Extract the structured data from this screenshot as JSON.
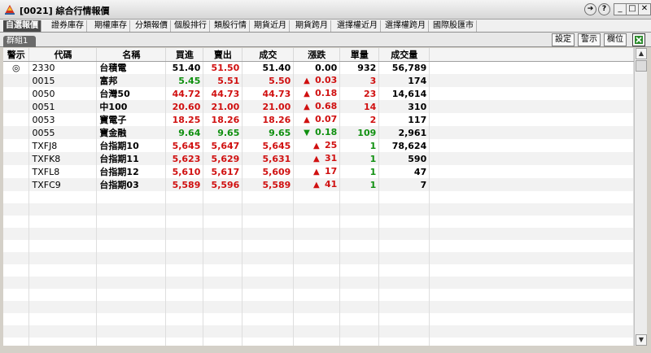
{
  "window": {
    "title": "[0021] 綜合行情報價",
    "help_glyph": "?",
    "next_glyph": "➔",
    "min_glyph": "_",
    "max_glyph": "□",
    "close_glyph": "✕"
  },
  "tabs": [
    {
      "label": "自選報價",
      "active": true
    },
    {
      "label": "證券庫存"
    },
    {
      "label": "期權庫存"
    },
    {
      "label": "分類報價"
    },
    {
      "label": "個股排行"
    },
    {
      "label": "類股行情"
    },
    {
      "label": "期貨近月"
    },
    {
      "label": "期貨跨月"
    },
    {
      "label": "選擇權近月"
    },
    {
      "label": "選擇權跨月"
    },
    {
      "label": "國際股匯市"
    }
  ],
  "toolbar": {
    "group_tab": "群組1",
    "settings": "設定",
    "alert": "警示",
    "columns": "欄位"
  },
  "table": {
    "headers": [
      "警示",
      "代碼",
      "名稱",
      "買進",
      "賣出",
      "成交",
      "漲跌",
      "單量",
      "成交量"
    ],
    "rows": [
      {
        "alert": "◎",
        "code": "2330",
        "name": "台積電",
        "bid": "51.40",
        "ask": "51.50",
        "last": "51.40",
        "dir": "",
        "change": "0.00",
        "qty": "932",
        "vol": "56,789",
        "bidc": "black",
        "askc": "red",
        "lastc": "black",
        "chgc": "black"
      },
      {
        "alert": "",
        "code": "0015",
        "name": "富邦",
        "bid": "5.45",
        "ask": "5.51",
        "last": "5.50",
        "dir": "▲",
        "change": "0.03",
        "qty": "3",
        "vol": "174",
        "bidc": "green",
        "askc": "red",
        "lastc": "red",
        "chgc": "red"
      },
      {
        "alert": "",
        "code": "0050",
        "name": "台灣50",
        "bid": "44.72",
        "ask": "44.73",
        "last": "44.73",
        "dir": "▲",
        "change": "0.18",
        "qty": "23",
        "vol": "14,614",
        "bidc": "red",
        "askc": "red",
        "lastc": "red",
        "chgc": "red"
      },
      {
        "alert": "",
        "code": "0051",
        "name": "中100",
        "bid": "20.60",
        "ask": "21.00",
        "last": "21.00",
        "dir": "▲",
        "change": "0.68",
        "qty": "14",
        "vol": "310",
        "bidc": "red",
        "askc": "red",
        "lastc": "red",
        "chgc": "red"
      },
      {
        "alert": "",
        "code": "0053",
        "name": "寶電子",
        "bid": "18.25",
        "ask": "18.26",
        "last": "18.26",
        "dir": "▲",
        "change": "0.07",
        "qty": "2",
        "vol": "117",
        "bidc": "red",
        "askc": "red",
        "lastc": "red",
        "chgc": "red"
      },
      {
        "alert": "",
        "code": "0055",
        "name": "寶金融",
        "bid": "9.64",
        "ask": "9.65",
        "last": "9.65",
        "dir": "▼",
        "change": "0.18",
        "qty": "109",
        "vol": "2,961",
        "bidc": "green",
        "askc": "green",
        "lastc": "green",
        "chgc": "green"
      },
      {
        "alert": "",
        "code": "TXFJ8",
        "name": "台指期10",
        "bid": "5,645",
        "ask": "5,647",
        "last": "5,645",
        "dir": "▲",
        "change": "25",
        "qty": "1",
        "vol": "78,624",
        "bidc": "red",
        "askc": "red",
        "lastc": "red",
        "chgc": "red"
      },
      {
        "alert": "",
        "code": "TXFK8",
        "name": "台指期11",
        "bid": "5,623",
        "ask": "5,629",
        "last": "5,631",
        "dir": "▲",
        "change": "31",
        "qty": "1",
        "vol": "590",
        "bidc": "red",
        "askc": "red",
        "lastc": "red",
        "chgc": "red"
      },
      {
        "alert": "",
        "code": "TXFL8",
        "name": "台指期12",
        "bid": "5,610",
        "ask": "5,617",
        "last": "5,609",
        "dir": "▲",
        "change": "17",
        "qty": "1",
        "vol": "47",
        "bidc": "red",
        "askc": "red",
        "lastc": "red",
        "chgc": "red"
      },
      {
        "alert": "",
        "code": "TXFC9",
        "name": "台指期03",
        "bid": "5,589",
        "ask": "5,596",
        "last": "5,589",
        "dir": "▲",
        "change": "41",
        "qty": "1",
        "vol": "7",
        "bidc": "red",
        "askc": "red",
        "lastc": "red",
        "chgc": "red"
      }
    ],
    "empty_rows": 13
  },
  "colors": {
    "up": "#d01010",
    "down": "#109010",
    "active_tab": "#4a4a4a"
  }
}
